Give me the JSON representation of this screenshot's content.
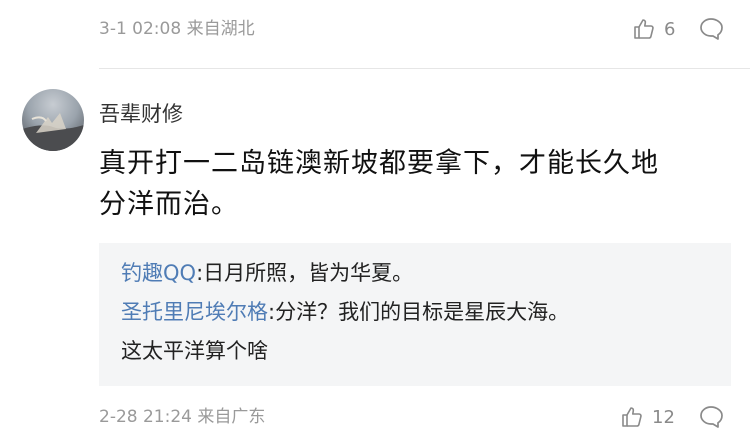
{
  "top_comment": {
    "timestamp": "3-1 02:08 来自湖北",
    "likes": "6"
  },
  "comment": {
    "username": "吾辈财修",
    "text_line1": "真开打一二岛链澳新坡都要拿下，才能长久地",
    "text_line2": "分洋而治。",
    "replies": [
      {
        "name": "钓趣QQ",
        "sep": ":",
        "text": "日月所照，皆为华夏。"
      },
      {
        "name": "圣托里尼埃尔格",
        "sep": ":",
        "text": "分洋？我们的目标是星辰大海。",
        "text_cont": "这太平洋算个啥"
      }
    ],
    "timestamp": "2-28 21:24 来自广东",
    "likes": "12"
  },
  "icons": {
    "like": "thumbs-up-icon",
    "reply": "speech-bubble-icon"
  }
}
